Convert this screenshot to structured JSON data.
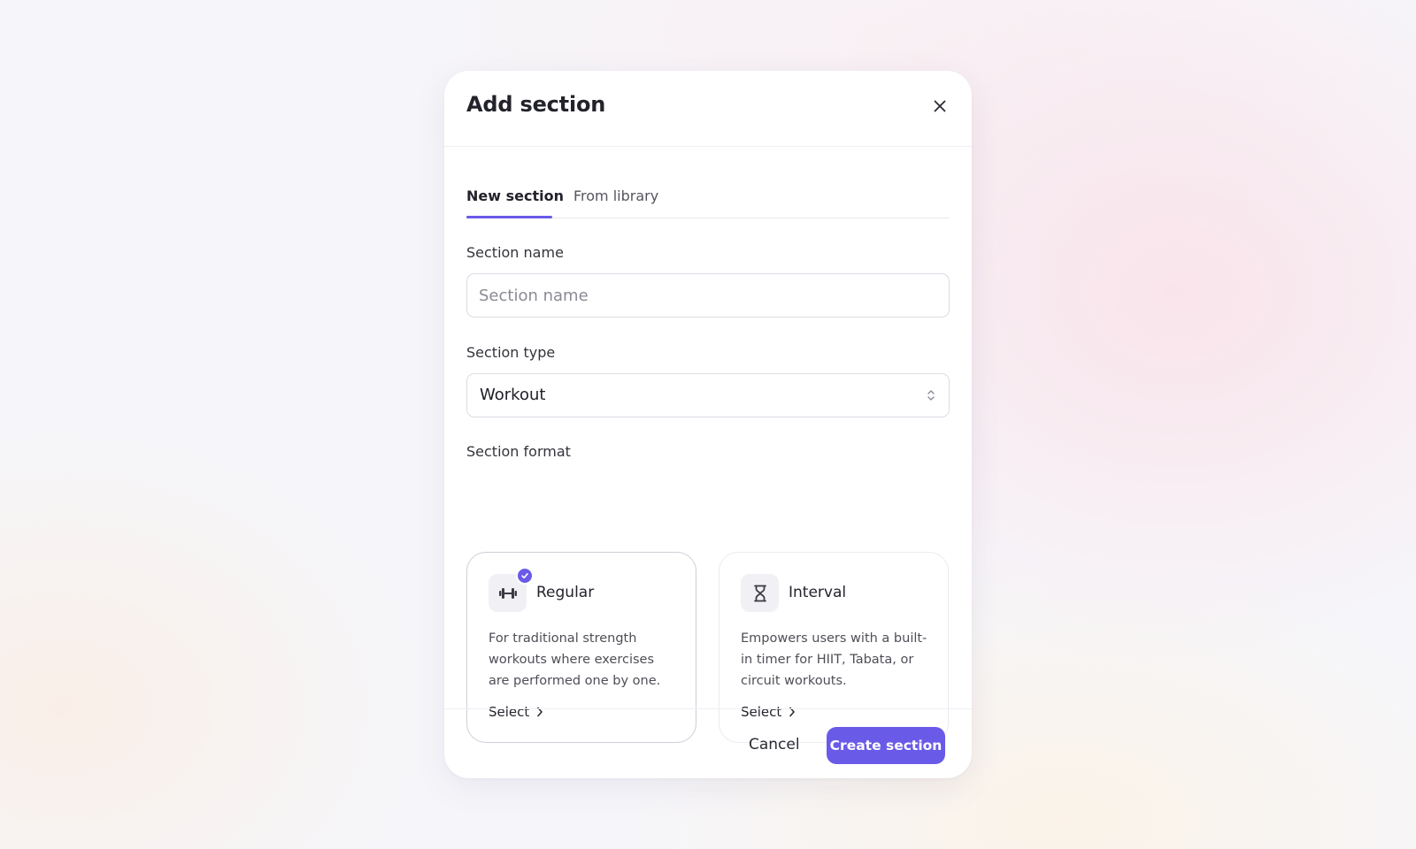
{
  "modal": {
    "title": "Add section",
    "close_icon": "close-icon"
  },
  "tabs": [
    {
      "label": "New section",
      "active": true
    },
    {
      "label": "From library",
      "active": false
    }
  ],
  "section_name": {
    "label": "Section name",
    "placeholder": "Section name",
    "value": ""
  },
  "section_type": {
    "label": "Section type",
    "value": "Workout",
    "icon": "chevron-up-down-icon"
  },
  "section_format": {
    "label": "Section format",
    "options": [
      {
        "title": "Regular",
        "icon": "dumbbell-icon",
        "selected": true,
        "description": "For traditional strength workouts where exercises are performed one by one.",
        "action_label": "Select"
      },
      {
        "title": "Interval",
        "icon": "hourglass-icon",
        "selected": false,
        "description": "Empowers users with a built-in timer for HIIT, Tabata, or circuit workouts.",
        "action_label": "Select"
      }
    ]
  },
  "footer": {
    "cancel_label": "Cancel",
    "create_label": "Create section"
  },
  "colors": {
    "accent": "#6a5ae8",
    "text": "#23232b",
    "muted": "#55555e"
  }
}
